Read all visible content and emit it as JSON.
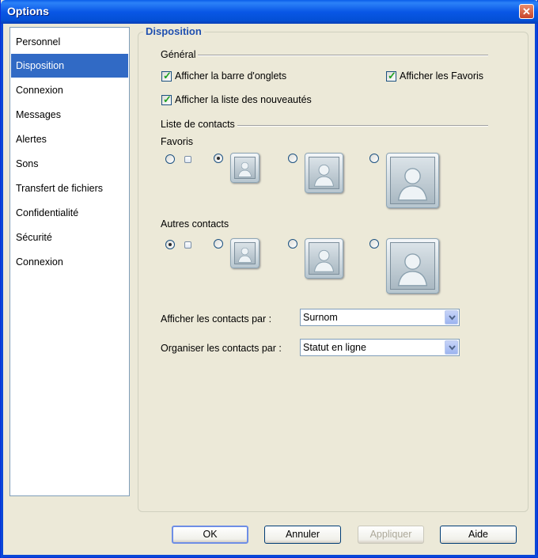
{
  "window": {
    "title": "Options"
  },
  "nav": {
    "items": [
      "Personnel",
      "Disposition",
      "Connexion",
      "Messages",
      "Alertes",
      "Sons",
      "Transfert de fichiers",
      "Confidentialité",
      "Sécurité",
      "Connexion"
    ],
    "active_index": 1
  },
  "panel": {
    "title": "Disposition"
  },
  "general": {
    "label": "Général",
    "show_tabs": {
      "label": "Afficher la barre d'onglets",
      "checked": true
    },
    "show_favorites": {
      "label": "Afficher les Favoris",
      "checked": true
    },
    "show_news": {
      "label": "Afficher la liste des nouveautés",
      "checked": true
    }
  },
  "contacts": {
    "label": "Liste de contacts",
    "favorites": {
      "label": "Favoris",
      "selected_size": "small"
    },
    "others": {
      "label": "Autres contacts",
      "selected_size": "none"
    },
    "size_options": [
      "none",
      "small",
      "medium",
      "large"
    ]
  },
  "display_by": {
    "label": "Afficher les contacts par  :",
    "value": "Surnom"
  },
  "organize_by": {
    "label": "Organiser les contacts par :",
    "value": "Statut en ligne"
  },
  "buttons": {
    "ok": "OK",
    "cancel": "Annuler",
    "apply": "Appliquer",
    "help": "Aide"
  },
  "colors": {
    "title_bar": "#0a5ee9",
    "selection": "#316ac5",
    "section_title": "#2050b0",
    "check_mark": "#21a121"
  },
  "icons": {
    "close": "close-icon",
    "avatar": "user-avatar-icon",
    "dropdown": "chevron-down-icon"
  }
}
